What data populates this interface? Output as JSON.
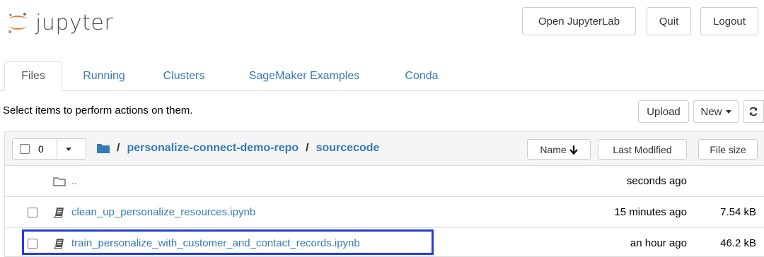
{
  "header": {
    "app_name": "jupyter",
    "buttons": {
      "open_jupyterlab": "Open JupyterLab",
      "quit": "Quit",
      "logout": "Logout"
    }
  },
  "tabs": [
    {
      "label": "Files",
      "active": true
    },
    {
      "label": "Running",
      "active": false
    },
    {
      "label": "Clusters",
      "active": false
    },
    {
      "label": "SageMaker Examples",
      "active": false
    },
    {
      "label": "Conda",
      "active": false
    }
  ],
  "toolbar": {
    "instructions": "Select items to perform actions on them.",
    "upload_label": "Upload",
    "new_label": "New"
  },
  "list": {
    "selected_count": "0",
    "breadcrumb": {
      "root": "/",
      "parts": [
        "personalize-connect-demo-repo",
        "sourcecode"
      ],
      "separator": "/"
    },
    "sort": {
      "name_label": "Name",
      "last_modified_label": "Last Modified",
      "file_size_label": "File size"
    },
    "rows": [
      {
        "type": "folder",
        "name": "..",
        "modified": "seconds ago",
        "size": ""
      },
      {
        "type": "notebook",
        "name": "clean_up_personalize_resources.ipynb",
        "modified": "15 minutes ago",
        "size": "7.54 kB"
      },
      {
        "type": "notebook",
        "name": "train_personalize_with_customer_and_contact_records.ipynb",
        "modified": "an hour ago",
        "size": "46.2 kB"
      }
    ]
  },
  "colors": {
    "link": "#337ab7",
    "highlight_border": "#1f3de0",
    "logo_orange": "#f37726"
  }
}
